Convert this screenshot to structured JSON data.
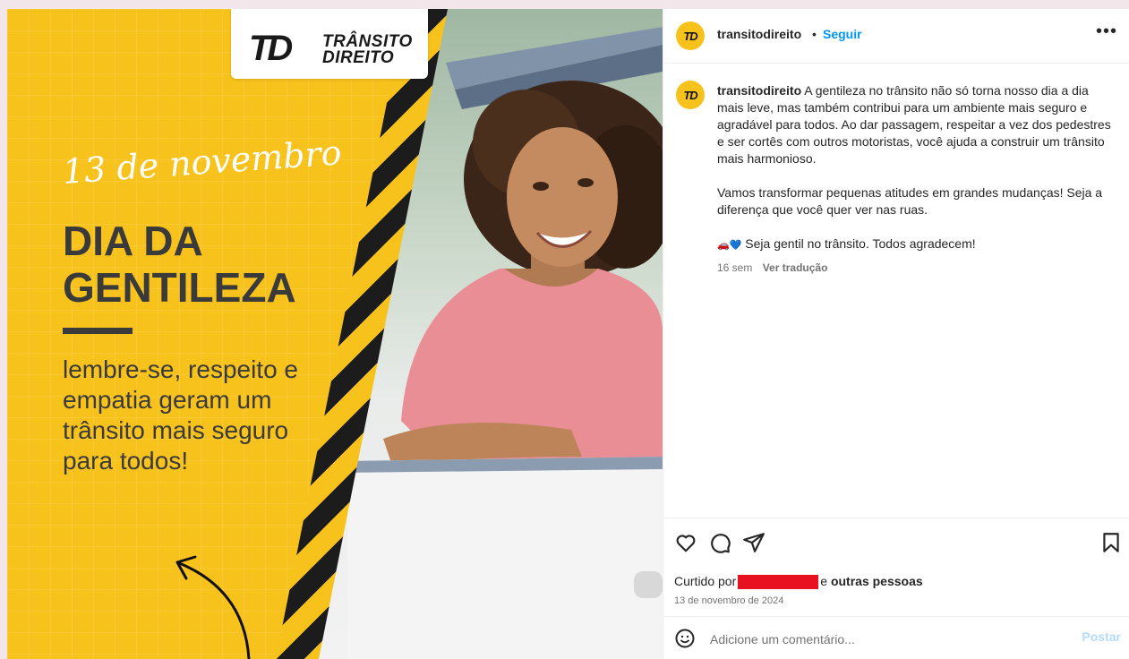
{
  "post_image": {
    "logo_mark": "TD",
    "logo_line1": "TRÂNSITO",
    "logo_line2": "DIREITO",
    "script_date": "13 de novembro",
    "headline_line1": "DIA DA",
    "headline_line2": "GENTILEZA",
    "message": "lembre-se, respeito e empatia geram um trânsito mais seguro para todos!",
    "colors": {
      "yellow": "#f8c21c",
      "dark": "#3a3a3a"
    }
  },
  "header": {
    "avatar_text": "TD",
    "username": "transitodireito",
    "separator": "•",
    "follow_label": "Seguir",
    "more_icon": "more-horizontal-icon"
  },
  "caption": {
    "avatar_text": "TD",
    "username": "transitodireito",
    "paragraph1": "A gentileza no trânsito não só torna nosso dia a dia mais leve, mas também contribui para um ambiente mais seguro e agradável para todos. Ao dar passagem, respeitar a vez dos pedestres e ser cortês com outros motoristas, você ajuda a construir um trânsito mais harmonioso.",
    "paragraph2": "Vamos transformar pequenas atitudes em grandes mudanças! Seja a diferença que você quer ver nas ruas.",
    "emojis": "🚗💙",
    "paragraph3": "Seja gentil no trânsito. Todos agradecem!",
    "age": "16 sem",
    "translate_label": "Ver tradução"
  },
  "actions": {
    "like_icon": "heart-icon",
    "comment_icon": "comment-icon",
    "share_icon": "share-icon",
    "save_icon": "bookmark-icon",
    "liked_by_prefix": "Curtido por",
    "liked_by_suffix_connector": "e",
    "liked_by_others": "outras pessoas",
    "date": "13 de novembro de 2024"
  },
  "comment_bar": {
    "emoji_icon": "emoji-icon",
    "placeholder": "Adicione um comentário...",
    "post_label": "Postar",
    "post_color": "#b3dbff"
  },
  "accent": {
    "link_blue": "#0095f6",
    "redaction_red": "#e8111f"
  }
}
